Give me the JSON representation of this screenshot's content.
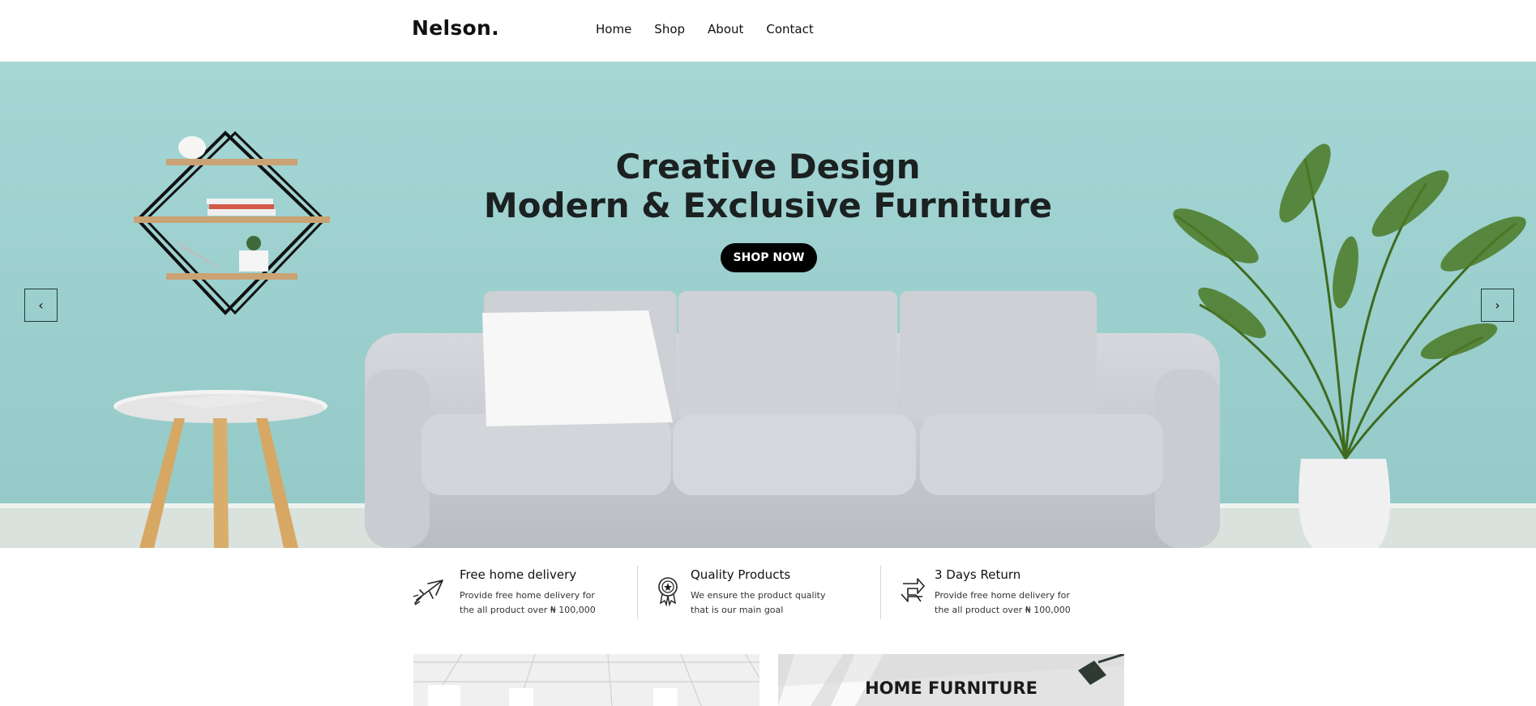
{
  "brand": {
    "logo": "Nelson."
  },
  "nav": {
    "items": [
      "Home",
      "Shop",
      "About",
      "Contact"
    ]
  },
  "hero": {
    "line1": "Creative Design",
    "line2": "Modern & Exclusive Furniture",
    "cta": "SHOP NOW",
    "prev_icon": "chevron-left-icon",
    "next_icon": "chevron-right-icon",
    "prev_glyph": "‹",
    "next_glyph": "›",
    "background_color": "#a0d4d2"
  },
  "features": [
    {
      "icon": "airplane-delivery-icon",
      "title": "Free home delivery",
      "desc": "Provide free home delivery for the all product over ₦ 100,000"
    },
    {
      "icon": "quality-badge-icon",
      "title": "Quality Products",
      "desc": "We ensure the product quality that is our main goal"
    },
    {
      "icon": "return-arrows-icon",
      "title": "3 Days Return",
      "desc": "Provide free home delivery for the all product over ₦ 100,000"
    }
  ],
  "cards": [
    {
      "title": ""
    },
    {
      "title": "HOME FURNITURE"
    }
  ]
}
